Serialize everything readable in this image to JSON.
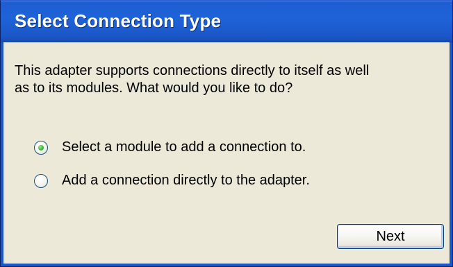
{
  "dialog": {
    "title": "Select Connection Type",
    "description_lines": [
      "This adapter supports connections directly to itself as well",
      "as to its modules. What would you like to do?"
    ],
    "options": [
      {
        "label": "Select a module to add a connection to.",
        "selected": true
      },
      {
        "label": "Add a connection directly to the adapter.",
        "selected": false
      }
    ],
    "next_label": "Next"
  },
  "colors": {
    "titlebar": "#1f63d9",
    "client_bg": "#ece9d8",
    "radio_selected_dot": "#3cbc3a"
  }
}
